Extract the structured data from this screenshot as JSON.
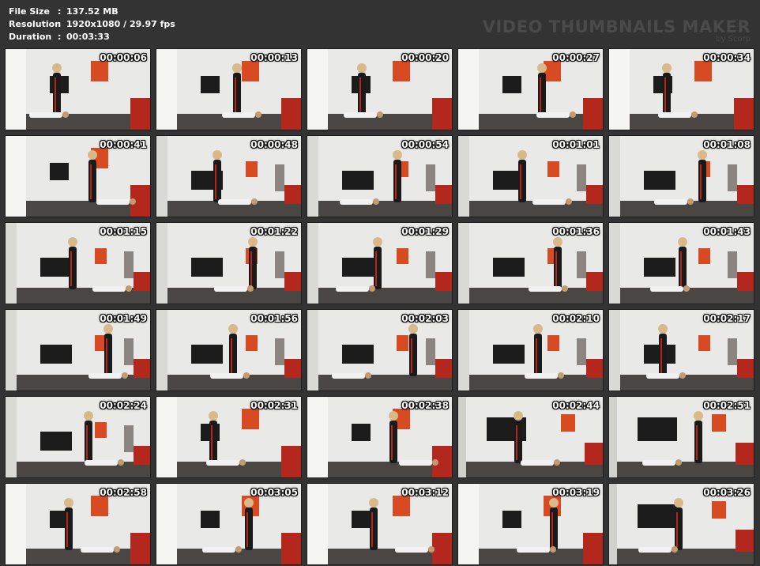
{
  "file_info": [
    {
      "key": "File Size",
      "value": "137.52 MB"
    },
    {
      "key": "Resolution",
      "value": "1920x1080 / 29.97 fps"
    },
    {
      "key": "Duration",
      "value": "00:03:33"
    }
  ],
  "brand": {
    "title": "VIDEO THUMBNAILS MAKER",
    "subtitle": "by Scorp"
  },
  "colors": {
    "background": "#333333",
    "wall": "#e9e9e7",
    "floor": "#4a4643",
    "sofa": "#b4271d",
    "painting": "#d84a22",
    "tv": "#1c1c1c"
  },
  "thumbnails": [
    {
      "time": "00:00:06",
      "scene": "a"
    },
    {
      "time": "00:00:13",
      "scene": "a"
    },
    {
      "time": "00:00:20",
      "scene": "a"
    },
    {
      "time": "00:00:27",
      "scene": "a"
    },
    {
      "time": "00:00:34",
      "scene": "a"
    },
    {
      "time": "00:00:41",
      "scene": "a"
    },
    {
      "time": "00:00:48",
      "scene": "b"
    },
    {
      "time": "00:00:54",
      "scene": "b"
    },
    {
      "time": "00:01:01",
      "scene": "b"
    },
    {
      "time": "00:01:08",
      "scene": "b"
    },
    {
      "time": "00:01:15",
      "scene": "b"
    },
    {
      "time": "00:01:22",
      "scene": "b"
    },
    {
      "time": "00:01:29",
      "scene": "b"
    },
    {
      "time": "00:01:36",
      "scene": "b"
    },
    {
      "time": "00:01:43",
      "scene": "b"
    },
    {
      "time": "00:01:49",
      "scene": "b"
    },
    {
      "time": "00:01:56",
      "scene": "b"
    },
    {
      "time": "00:02:03",
      "scene": "b"
    },
    {
      "time": "00:02:10",
      "scene": "b"
    },
    {
      "time": "00:02:17",
      "scene": "b"
    },
    {
      "time": "00:02:24",
      "scene": "b"
    },
    {
      "time": "00:02:31",
      "scene": "a"
    },
    {
      "time": "00:02:38",
      "scene": "a"
    },
    {
      "time": "00:02:44",
      "scene": "c"
    },
    {
      "time": "00:02:51",
      "scene": "c"
    },
    {
      "time": "00:02:58",
      "scene": "a"
    },
    {
      "time": "00:03:05",
      "scene": "a"
    },
    {
      "time": "00:03:12",
      "scene": "a"
    },
    {
      "time": "00:03:19",
      "scene": "a"
    },
    {
      "time": "00:03:26",
      "scene": "c"
    }
  ]
}
